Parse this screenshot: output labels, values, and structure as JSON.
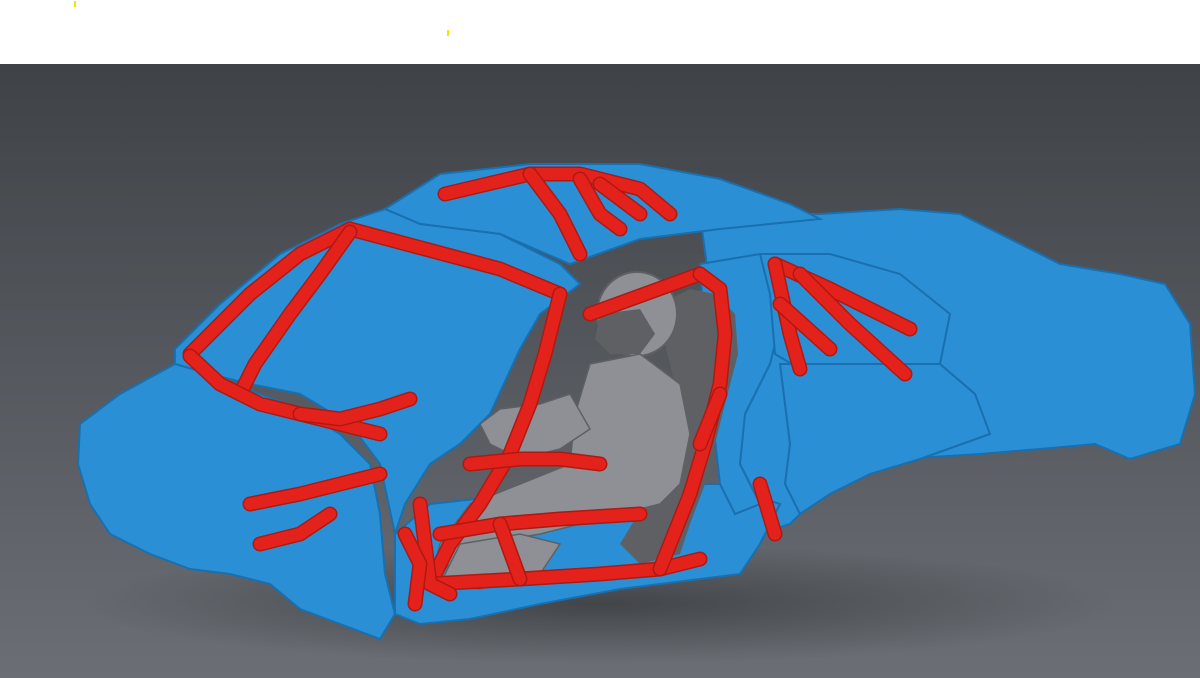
{
  "scene": {
    "subject": "3d-scan-car-body-with-roll-cage-and-driver",
    "colors": {
      "background_top": "#3f4247",
      "background_bottom": "#6b6f75",
      "body_shell": "#2a8fd4",
      "body_shell_dark": "#1a6fae",
      "roll_cage": "#e3231b",
      "roll_cage_dark": "#b01812",
      "driver": "#8e9095",
      "driver_dark": "#5e6064",
      "marker": "#f5e400"
    }
  },
  "markers": [
    {
      "id": "yellow-tick-a"
    },
    {
      "id": "yellow-tick-b"
    }
  ]
}
